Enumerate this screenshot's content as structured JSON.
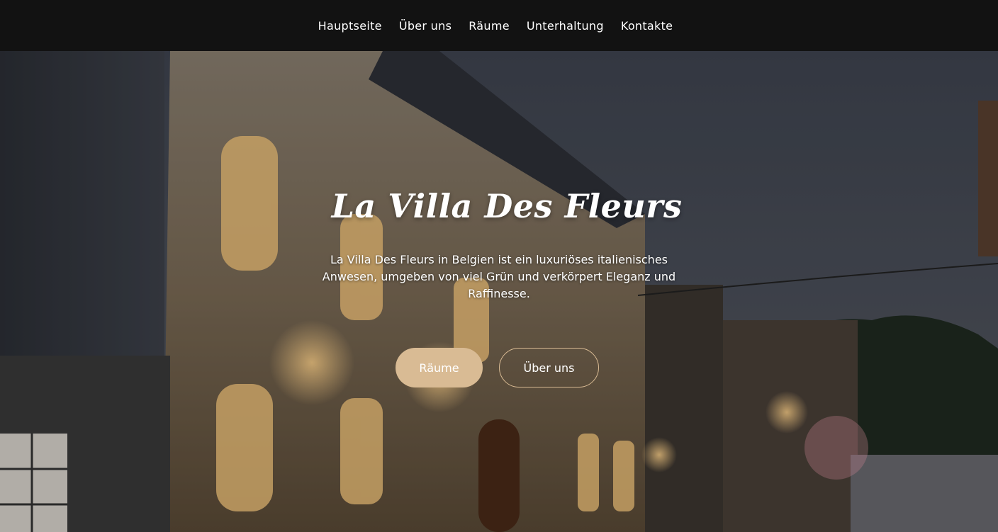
{
  "nav": {
    "items": [
      {
        "label": "Hauptseite"
      },
      {
        "label": "Über uns"
      },
      {
        "label": "Räume"
      },
      {
        "label": "Unterhaltung"
      },
      {
        "label": "Kontakte"
      }
    ]
  },
  "hero": {
    "title": "La Villa Des Fleurs",
    "lead": "La Villa Des Fleurs in Belgien ist ein luxuriöses italienisches Anwesen, umgeben von viel Grün und verkörpert Eleganz und Raffinesse.",
    "primary_button": "Räume",
    "secondary_button": "Über uns"
  },
  "colors": {
    "nav_bg": "#121212",
    "accent": "#d9bb94"
  }
}
